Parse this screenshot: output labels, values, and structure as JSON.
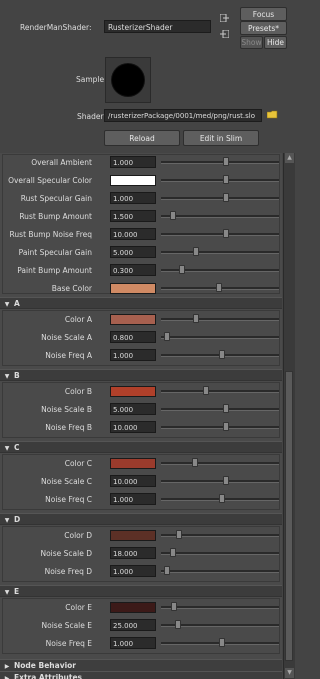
{
  "header": {
    "shader_node_label": "RenderManShader:",
    "shader_node_value": "RusterizerShader",
    "focus_label": "Focus",
    "presets_label": "Presets*",
    "show_label": "Show",
    "hide_label": "Hide",
    "sample_label": "Sample",
    "shader_label": "Shader",
    "shader_path": "/rusterizerPackage/0001/med/png/rust.slo",
    "reload_label": "Reload",
    "edit_label": "Edit in Slim"
  },
  "main_params": [
    {
      "label": "Overall Ambient",
      "value": "1.000",
      "slider": 0.55
    },
    {
      "label": "Overall Specular Color",
      "color": "#ffffff",
      "slider": 0.55
    },
    {
      "label": "Rust Specular Gain",
      "value": "1.000",
      "slider": 0.55
    },
    {
      "label": "Rust Bump Amount",
      "value": "1.500",
      "slider": 0.1
    },
    {
      "label": "Rust Bump Noise Freq",
      "value": "10.000",
      "slider": 0.55
    },
    {
      "label": "Paint Specular Gain",
      "value": "5.000",
      "slider": 0.3
    },
    {
      "label": "Paint Bump Amount",
      "value": "0.300",
      "slider": 0.18
    },
    {
      "label": "Base Color",
      "color": "#d08a64",
      "slider": 0.49
    }
  ],
  "sections": [
    {
      "title": "A",
      "rows": [
        {
          "label": "Color A",
          "color": "#a7604f",
          "slider": 0.3
        },
        {
          "label": "Noise Scale A",
          "value": "0.800",
          "slider": 0.05
        },
        {
          "label": "Noise Freq A",
          "value": "1.000",
          "slider": 0.52
        }
      ]
    },
    {
      "title": "B",
      "rows": [
        {
          "label": "Color B",
          "color": "#b0402a",
          "slider": 0.38
        },
        {
          "label": "Noise Scale B",
          "value": "5.000",
          "slider": 0.55
        },
        {
          "label": "Noise Freq B",
          "value": "10.000",
          "slider": 0.55
        }
      ]
    },
    {
      "title": "C",
      "rows": [
        {
          "label": "Color C",
          "color": "#9b3b2c",
          "slider": 0.29
        },
        {
          "label": "Noise Scale C",
          "value": "10.000",
          "slider": 0.55
        },
        {
          "label": "Noise Freq C",
          "value": "1.000",
          "slider": 0.52
        }
      ]
    },
    {
      "title": "D",
      "rows": [
        {
          "label": "Color D",
          "color": "#5c3026",
          "slider": 0.15
        },
        {
          "label": "Noise Scale D",
          "value": "18.000",
          "slider": 0.1
        },
        {
          "label": "Noise Freq D",
          "value": "1.000",
          "slider": 0.05
        }
      ]
    },
    {
      "title": "E",
      "rows": [
        {
          "label": "Color E",
          "color": "#3c1a18",
          "slider": 0.11
        },
        {
          "label": "Noise Scale E",
          "value": "25.000",
          "slider": 0.14
        },
        {
          "label": "Noise Freq E",
          "value": "1.000",
          "slider": 0.52
        }
      ]
    }
  ],
  "bottom_sections": [
    "Node Behavior",
    "Extra Attributes"
  ]
}
